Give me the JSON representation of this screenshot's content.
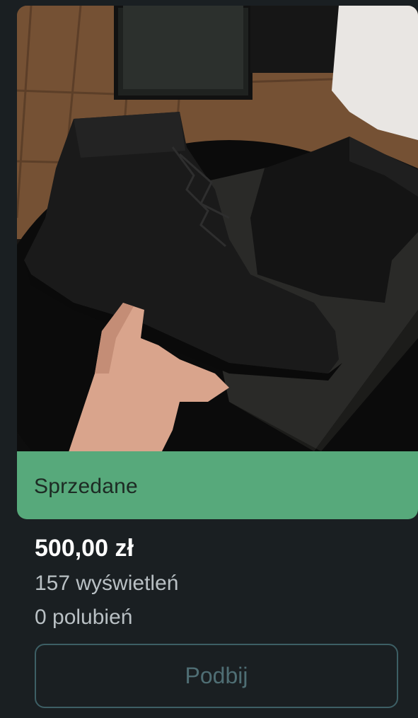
{
  "listing": {
    "image_alt_subject": "black-lace-up-boots-photo",
    "status_label": "Sprzedane",
    "price": "500,00 zł",
    "views": "157 wyświetleń",
    "likes": "0 polubień",
    "boost_label": "Podbij"
  },
  "colors": {
    "background": "#1a1f22",
    "status_green": "#57a97b",
    "price_text": "#ffffff",
    "muted_text": "#b9c0c4",
    "button_border": "#3d5f65",
    "button_text": "#4f6e74"
  }
}
